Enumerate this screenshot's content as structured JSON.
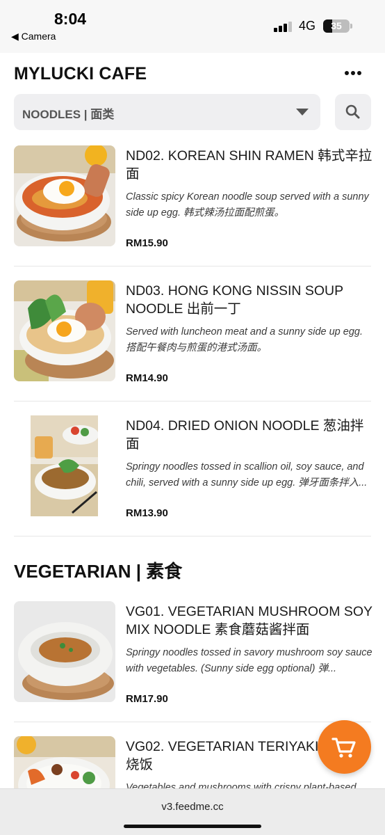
{
  "status_bar": {
    "time": "8:04",
    "back_label": "◀ Camera",
    "network": "4G",
    "battery": "35"
  },
  "header": {
    "brand": "MYLUCKI CAFE",
    "more_icon": "ellipsis-icon"
  },
  "category_select": {
    "selected": "NOODLES | 面类",
    "caret_icon": "chevron-down-icon"
  },
  "search": {
    "icon": "search-icon"
  },
  "noodles": [
    {
      "title": "ND02. KOREAN SHIN RAMEN 韩式辛拉面",
      "description": "Classic spicy Korean noodle soup served with a sunny side up egg. 韩式辣汤拉面配煎蛋。",
      "price": "RM15.90"
    },
    {
      "title": "ND03. HONG KONG NISSIN SOUP NOODLE 出前一丁",
      "description": "Served with luncheon meat and a sunny side up egg. 搭配午餐肉与煎蛋的港式汤面。",
      "price": "RM14.90"
    },
    {
      "title": "ND04. DRIED ONION NOODLE 葱油拌面",
      "description": "Springy noodles tossed in scallion oil, soy sauce, and chili, served with a sunny side up egg. 弹牙面条拌入...",
      "price": "RM13.90"
    }
  ],
  "vegetarian_section": {
    "title": "VEGETARIAN | 素食",
    "items": [
      {
        "title": "VG01. VEGETARIAN MUSHROOM SOY MIX NOODLE 素食蘑菇酱拌面",
        "description": "Springy noodles tossed in savory mushroom soy sauce with vegetables. (Sunny side egg optional) 弹...",
        "price": "RM17.90"
      },
      {
        "title": "VG02. VEGETARIAN TERIYAKI R 食照烧饭",
        "description": "Vegetables and mushrooms with crispy plant-based"
      }
    ]
  },
  "cart": {
    "icon": "cart-icon"
  },
  "browser": {
    "url": "v3.feedme.cc"
  }
}
